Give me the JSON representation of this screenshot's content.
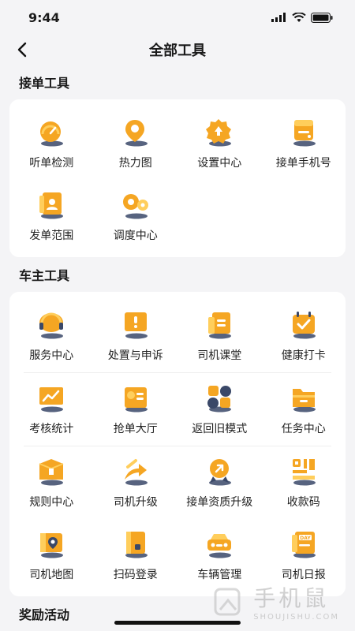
{
  "status": {
    "time": "9:44"
  },
  "header": {
    "title": "全部工具"
  },
  "sections": [
    {
      "title": "接单工具",
      "rows": [
        [
          {
            "label": "听单检测",
            "icon": "gauge-icon"
          },
          {
            "label": "热力图",
            "icon": "location-pin-icon"
          },
          {
            "label": "设置中心",
            "icon": "settings-gear-icon"
          },
          {
            "label": "接单手机号",
            "icon": "phone-card-icon"
          }
        ],
        [
          {
            "label": "发单范围",
            "icon": "range-card-icon"
          },
          {
            "label": "调度中心",
            "icon": "dispatch-icon"
          }
        ]
      ]
    },
    {
      "title": "车主工具",
      "rows": [
        [
          {
            "label": "服务中心",
            "icon": "headset-icon"
          },
          {
            "label": "处置与申诉",
            "icon": "appeal-icon"
          },
          {
            "label": "司机课堂",
            "icon": "classroom-icon"
          },
          {
            "label": "健康打卡",
            "icon": "health-checkin-icon"
          }
        ],
        [
          {
            "label": "考核统计",
            "icon": "statistics-board-icon"
          },
          {
            "label": "抢单大厅",
            "icon": "grab-order-icon"
          },
          {
            "label": "返回旧模式",
            "icon": "old-mode-icon"
          },
          {
            "label": "任务中心",
            "icon": "task-folder-icon"
          }
        ],
        [
          {
            "label": "规则中心",
            "icon": "rules-box-icon"
          },
          {
            "label": "司机升级",
            "icon": "upgrade-arrow-icon"
          },
          {
            "label": "接单资质升级",
            "icon": "qualification-badge-icon"
          },
          {
            "label": "收款码",
            "icon": "qr-code-icon"
          }
        ],
        [
          {
            "label": "司机地图",
            "icon": "driver-map-icon"
          },
          {
            "label": "扫码登录",
            "icon": "scan-login-icon"
          },
          {
            "label": "车辆管理",
            "icon": "car-icon"
          },
          {
            "label": "司机日报",
            "icon": "daily-report-icon"
          }
        ]
      ]
    },
    {
      "title": "奖励活动",
      "rows": []
    }
  ],
  "watermark": {
    "cn": "手机鼠",
    "en": "SHOUJISHU.COM"
  },
  "colors": {
    "accent": "#f5a623",
    "accent_light": "#ffd06a",
    "shadow": "#3b4a6b"
  }
}
